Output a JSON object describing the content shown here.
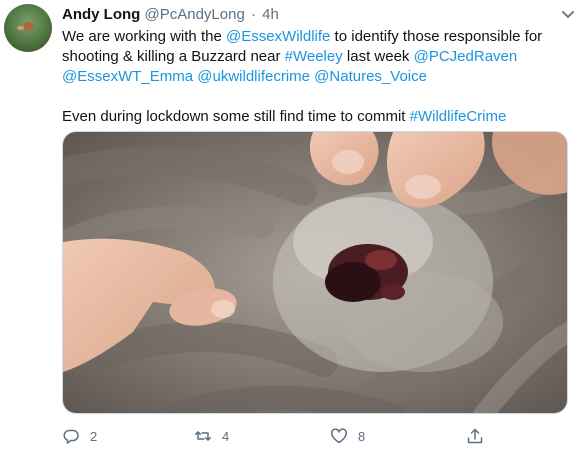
{
  "tweet": {
    "author": {
      "name": "Andy Long",
      "handle": "@PcAndyLong",
      "separator": "·",
      "time": "4h"
    },
    "body": {
      "p1": [
        {
          "text": "We are working with the ",
          "link": false
        },
        {
          "text": "@EssexWildlife",
          "link": true
        },
        {
          "text": " to identify those responsible for shooting & killing a Buzzard near ",
          "link": false
        },
        {
          "text": "#Weeley",
          "link": true
        },
        {
          "text": " last week ",
          "link": false
        },
        {
          "text": "@PCJedRaven",
          "link": true
        },
        {
          "text": " ",
          "link": false
        },
        {
          "text": "@EssexWT_Emma",
          "link": true
        },
        {
          "text": " ",
          "link": false
        },
        {
          "text": "@ukwildlifecrime",
          "link": true
        },
        {
          "text": " ",
          "link": false
        },
        {
          "text": "@Natures_Voice",
          "link": true
        }
      ],
      "p2": [
        {
          "text": "Even during lockdown some still find time to commit ",
          "link": false
        },
        {
          "text": "#WildlifeCrime",
          "link": true
        }
      ]
    },
    "actions": {
      "reply": {
        "icon": "reply-icon",
        "count": "2"
      },
      "retweet": {
        "icon": "retweet-icon",
        "count": "4"
      },
      "like": {
        "icon": "heart-icon",
        "count": "8"
      },
      "share": {
        "icon": "share-icon"
      }
    },
    "colors": {
      "link": "#1b95e0",
      "secondary": "#5b7083",
      "text": "#0f1419"
    }
  }
}
